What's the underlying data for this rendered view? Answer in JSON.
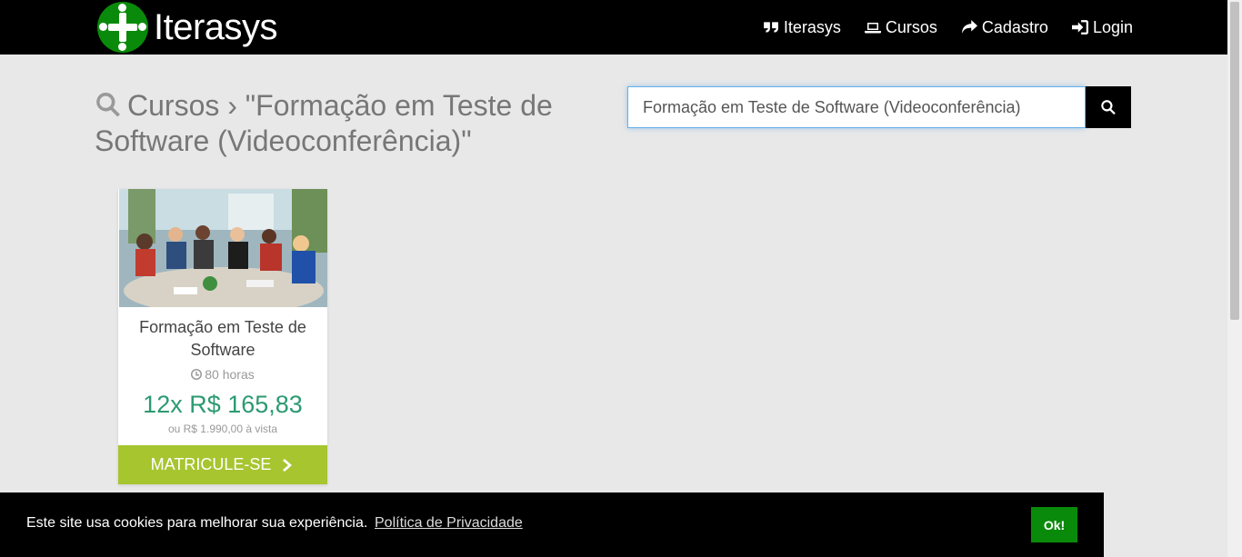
{
  "brand": {
    "name": "Iterasys"
  },
  "nav": {
    "items": [
      {
        "label": "Iterasys",
        "icon": "quote-icon"
      },
      {
        "label": "Cursos",
        "icon": "laptop-icon"
      },
      {
        "label": "Cadastro",
        "icon": "share-arrow-icon"
      },
      {
        "label": "Login",
        "icon": "sign-in-icon"
      }
    ]
  },
  "page": {
    "title": "Cursos › \"Formação em Teste de Software (Videoconferência)\""
  },
  "search": {
    "value": "Formação em Teste de Software (Videoconferência)",
    "placeholder": ""
  },
  "course_card": {
    "title": "Formação em Teste de Software",
    "hours": "80 horas",
    "price": "12x R$ 165,83",
    "price_note": "ou R$ 1.990,00 à vista",
    "button_label": "MATRICULE-SE"
  },
  "cookie": {
    "message": "Este site usa cookies para melhorar sua experiência.",
    "link_label": "Política de Privacidade",
    "ok_label": "Ok!"
  },
  "colors": {
    "navbar": "#000000",
    "logo_green": "#0a8a0a",
    "price_green": "#2c9a72",
    "enroll_button": "#a7c52f",
    "background": "#e8e8e8"
  }
}
